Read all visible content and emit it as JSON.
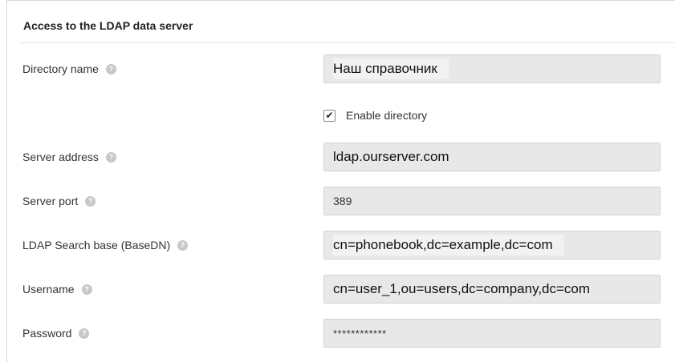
{
  "section": {
    "title": "Access to the LDAP data server"
  },
  "fields": [
    {
      "label": "Directory name",
      "value": "Наш справочник"
    },
    {
      "label": "Server address",
      "value": "ldap.ourserver.com"
    },
    {
      "label": "Server port",
      "value": "389"
    },
    {
      "label": "LDAP Search base (BaseDN)",
      "value": "cn=phonebook,dc=example,dc=com"
    },
    {
      "label": "Username",
      "value": "cn=user_1,ou=users,dc=company,dc=com"
    },
    {
      "label": "Password",
      "value": "************"
    }
  ],
  "enable_directory": {
    "label": "Enable directory",
    "checked": true
  },
  "icons": {
    "help": "help-icon",
    "check": "checkmark-icon"
  }
}
